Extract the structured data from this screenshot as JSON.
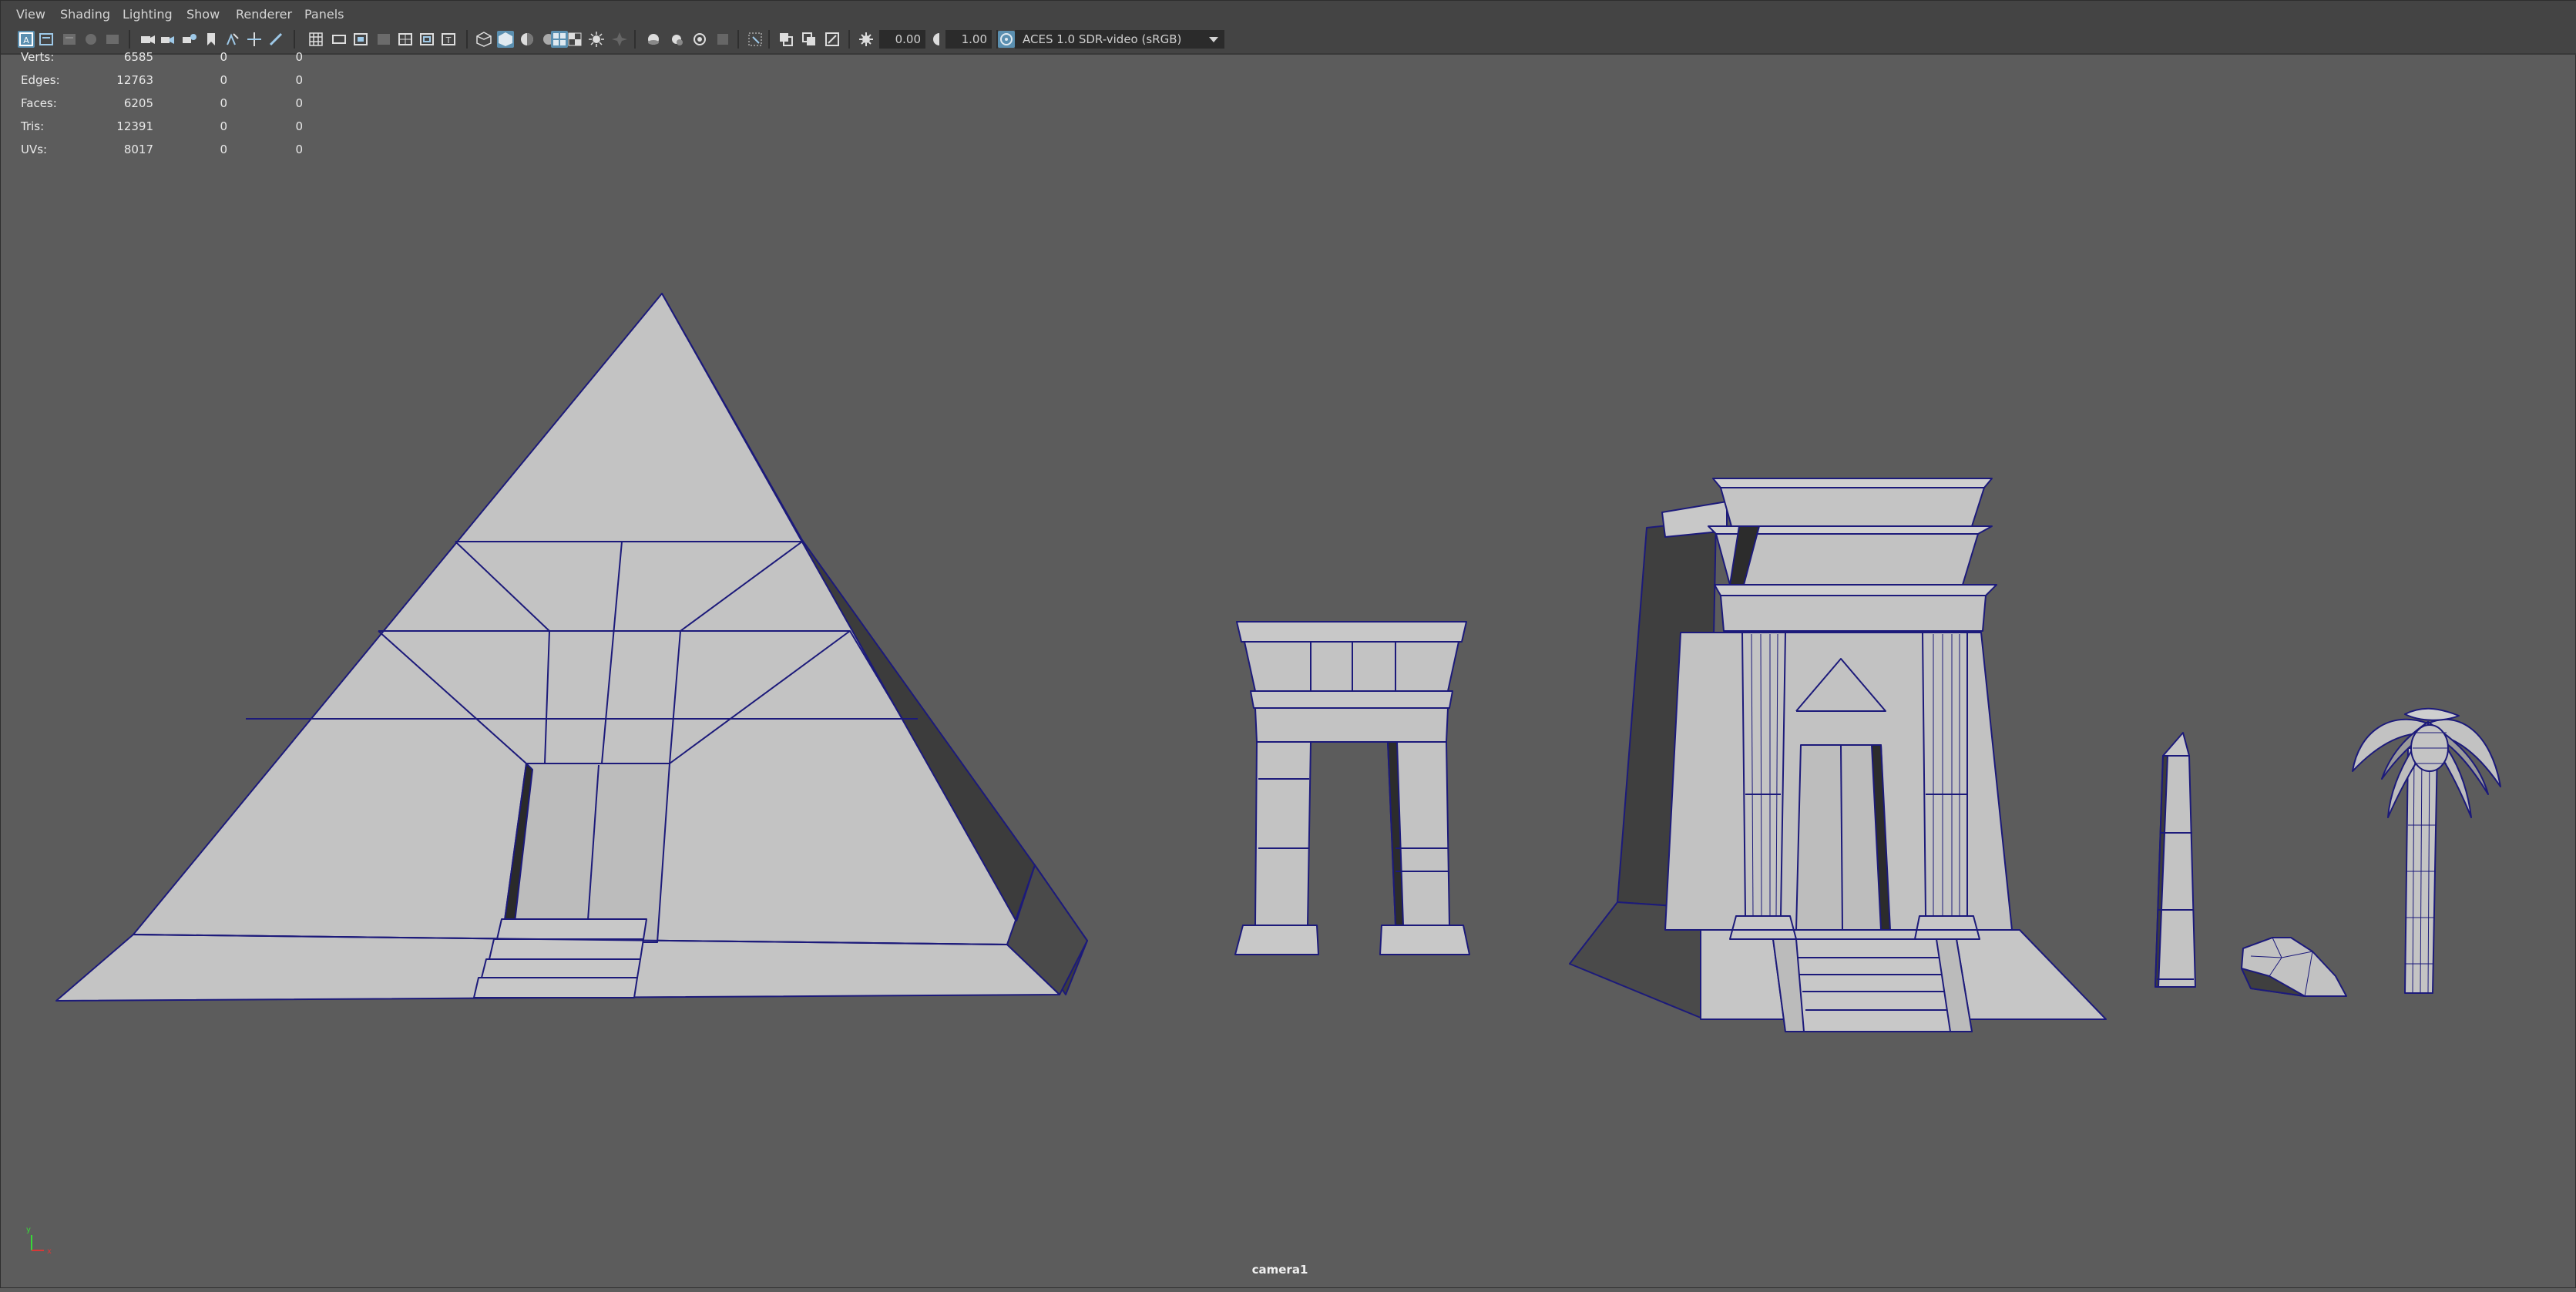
{
  "menu": [
    "View",
    "Shading",
    "Lighting",
    "Show",
    "Renderer",
    "Panels"
  ],
  "toolbar": {
    "exposure": "0.00",
    "gamma": "1.00",
    "color_space": "ACES 1.0 SDR-video (sRGB)",
    "icons": [
      "select-camera-icon",
      "camera-attributes-icon",
      "bookmark-icon",
      "image-plane-icon",
      "2d-pan-zoom-icon",
      "grease-pencil-icon",
      "camera-icon",
      "grid-icon",
      "film-gate-icon",
      "resolution-gate-icon",
      "gate-mask-icon",
      "field-chart-icon",
      "safe-action-icon",
      "safe-title-icon",
      "wireframe-icon",
      "smooth-shade-icon",
      "wireframe-on-shaded-icon",
      "xray-icon",
      "textured-icon",
      "lighting-icon",
      "shadows-icon",
      "screen-space-ao-icon",
      "motion-blur-icon",
      "antialias-icon",
      "depth-of-field-icon",
      "isolate-select-icon",
      "xray-joints-icon",
      "xray-active-icon",
      "backface-culling-icon",
      "exposure-icon",
      "gamma-icon",
      "view-transform-icon"
    ]
  },
  "hud": {
    "rows": [
      {
        "label": "Verts:",
        "a": "6585",
        "b": "0",
        "c": "0"
      },
      {
        "label": "Edges:",
        "a": "12763",
        "b": "0",
        "c": "0"
      },
      {
        "label": "Faces:",
        "a": "6205",
        "b": "0",
        "c": "0"
      },
      {
        "label": "Tris:",
        "a": "12391",
        "b": "0",
        "c": "0"
      },
      {
        "label": "UVs:",
        "a": "8017",
        "b": "0",
        "c": "0"
      }
    ]
  },
  "viewport": {
    "camera": "camera1",
    "models": [
      "pyramid",
      "gate",
      "temple",
      "obelisk",
      "rock",
      "palm-tree"
    ],
    "colors": {
      "background": "#5c5c5c",
      "surface": "#c3c3c3",
      "shadow": "#3d3d3d",
      "wire": "#1c1a7a"
    }
  }
}
